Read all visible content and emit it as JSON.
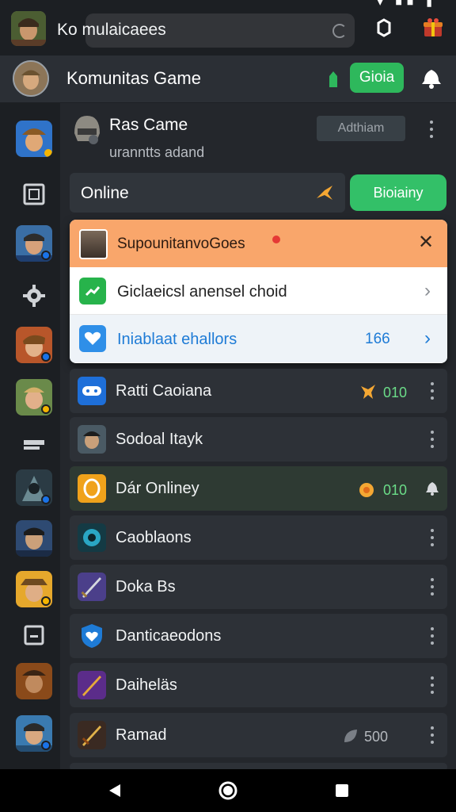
{
  "search": {
    "title": "Ko mulaicaees"
  },
  "header": {
    "title": "Komunitas Game",
    "action_label": "Gioia"
  },
  "game": {
    "title": "Ras Came",
    "subtitle": "uranntts adand",
    "button_label": "Adthiam"
  },
  "online": {
    "label": "Online",
    "button_label": "Bioiainy"
  },
  "popup": {
    "title": "SupounitanvoGoes",
    "row1_label": "Giclaeicsl anensel choid",
    "row2_label": "Iniablaat ehallors",
    "row2_count": "166"
  },
  "list": [
    {
      "label": "Ratti Caoiana",
      "count": "010",
      "icon": "gamepad-icon"
    },
    {
      "label": "Sodoal Itayk",
      "count": "",
      "icon": "avatar-icon"
    },
    {
      "label": "Dár Onliney",
      "count": "010",
      "icon": "coin-icon"
    },
    {
      "label": "Caoblaons",
      "count": "",
      "icon": "robot-icon"
    },
    {
      "label": "Doka Bs",
      "count": "",
      "icon": "sword-icon"
    },
    {
      "label": "Danticaeodons",
      "count": "",
      "icon": "heart-shield-icon"
    },
    {
      "label": "Daiheläs",
      "count": "",
      "icon": "magic-sword-icon"
    },
    {
      "label": "Ramad",
      "count": "500",
      "icon": "sword-icon"
    }
  ],
  "colors": {
    "accent_green": "#2eb85c",
    "popup_header": "#f9a66b",
    "link_blue": "#1e7bd6"
  }
}
